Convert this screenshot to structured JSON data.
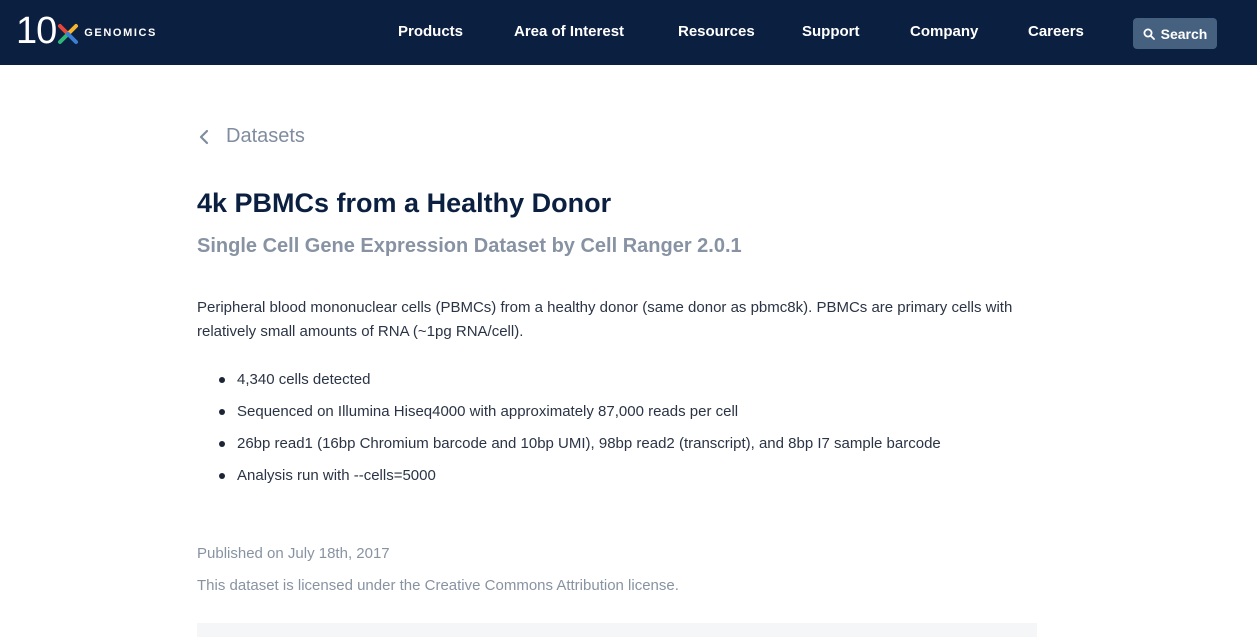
{
  "header": {
    "logo_number": "10",
    "logo_word": "GENOMICS",
    "logo_colors": [
      "#e8463a",
      "#f5b52e",
      "#2fb57a",
      "#3b7fd4"
    ],
    "nav": [
      {
        "label": "Products"
      },
      {
        "label": "Area of Interest"
      },
      {
        "label": "Resources"
      },
      {
        "label": "Support"
      },
      {
        "label": "Company"
      },
      {
        "label": "Careers"
      }
    ],
    "search_label": "Search",
    "search_icon": "search-icon"
  },
  "breadcrumb": {
    "label": "Datasets",
    "icon": "chevron-left-icon"
  },
  "dataset": {
    "title": "4k PBMCs from a Healthy Donor",
    "subtitle": "Single Cell Gene Expression Dataset by Cell Ranger 2.0.1",
    "description": "Peripheral blood mononuclear cells (PBMCs) from a healthy donor (same donor as pbmc8k). PBMCs are primary cells with relatively small amounts of RNA (~1pg RNA/cell).",
    "details": [
      "4,340 cells detected",
      "Sequenced on Illumina Hiseq4000 with approximately 87,000 reads per cell",
      "26bp read1 (16bp Chromium barcode and 10bp UMI), 98bp read2 (transcript), and 8bp I7 sample barcode",
      "Analysis run with --cells=5000"
    ],
    "published": "Published on July 18th, 2017",
    "license": "This dataset is licensed under the Creative Commons Attribution license."
  },
  "colors": {
    "navbar": "#0b1f40",
    "search_button": "#46617f",
    "muted_text": "#8893a2"
  }
}
